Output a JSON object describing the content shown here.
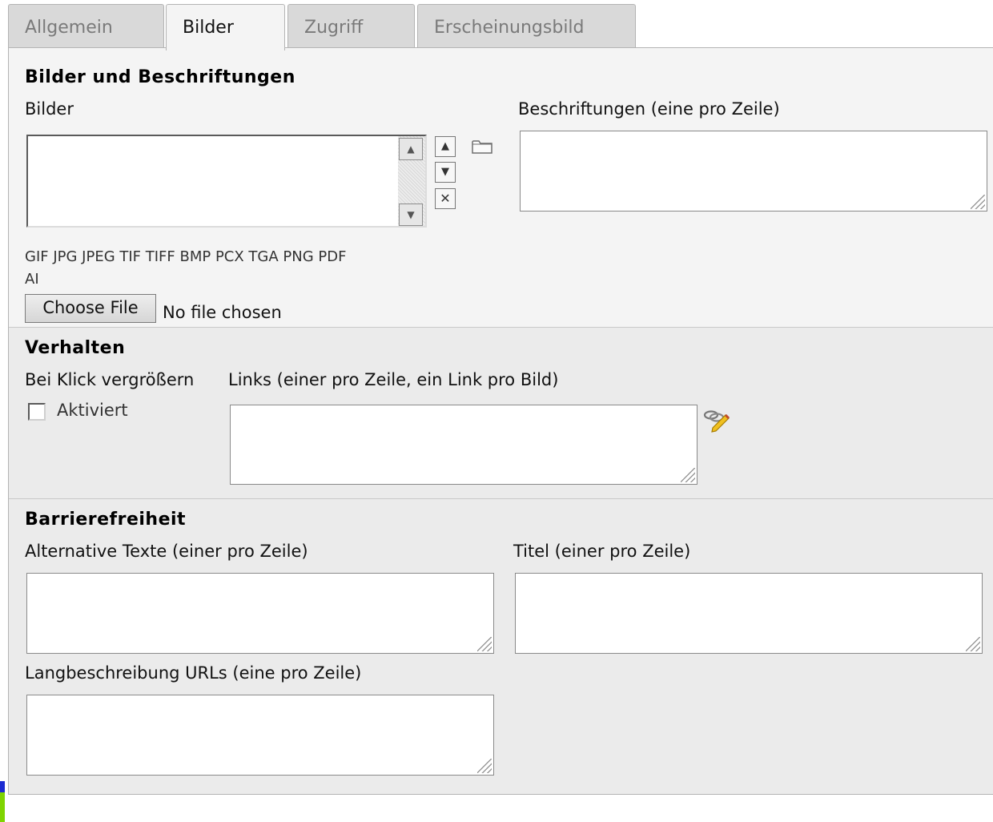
{
  "tabs": [
    "Allgemein",
    "Bilder",
    "Zugriff",
    "Erscheinungsbild"
  ],
  "active_tab": "Bilder",
  "images_section": {
    "heading": "Bilder und Beschriftungen",
    "images_label": "Bilder",
    "captions_label": "Beschriftungen (eine pro Zeile)",
    "allowed_types_line1": "GIF JPG JPEG TIF TIFF BMP PCX TGA PNG PDF",
    "allowed_types_line2": "AI",
    "file_button": "Choose File",
    "file_status": "No file chosen"
  },
  "behavior_section": {
    "heading": "Verhalten",
    "zoom_label": "Bei Klick vergrößern",
    "zoom_checkbox_label": "Aktiviert",
    "zoom_checked": false,
    "links_label": "Links (einer pro Zeile, ein Link pro Bild)"
  },
  "accessibility_section": {
    "heading": "Barrierefreiheit",
    "alt_label": "Alternative Texte (einer pro Zeile)",
    "title_label": "Titel (einer pro Zeile)",
    "longdesc_label": "Langbeschreibung URLs (eine pro Zeile)"
  },
  "colors": {
    "panel_bg": "#ebebeb",
    "active_section_bg": "#f4f4f4",
    "tab_bg": "#d9d9d9",
    "left_strip_blue": "#1c2bd1",
    "left_strip_green": "#7fd400"
  }
}
